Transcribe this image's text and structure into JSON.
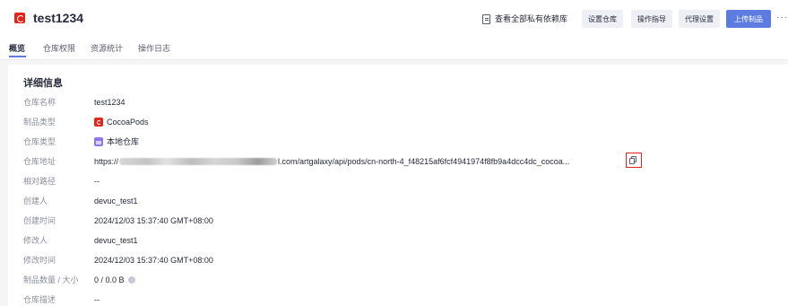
{
  "header": {
    "title": "test1234",
    "deps_link": "查看全部私有依赖库",
    "buttons": {
      "settings": "设置仓库",
      "guide": "操作指导",
      "proxy": "代理设置",
      "upload": "上传制品"
    },
    "more": "···"
  },
  "tabs": [
    {
      "label": "概览",
      "active": true
    },
    {
      "label": "仓库权限"
    },
    {
      "label": "资源统计"
    },
    {
      "label": "操作日志"
    }
  ],
  "detail": {
    "section_title": "详细信息",
    "rows": [
      {
        "label": "仓库名称",
        "value": "test1234"
      },
      {
        "label": "制品类型",
        "value": "CocoaPods",
        "icon": "cocoapods-icon"
      },
      {
        "label": "仓库类型",
        "value": "本地仓库",
        "icon": "local-repo-icon"
      },
      {
        "label": "仓库地址",
        "url_prefix": "https://",
        "url_suffix": "l.com/artgalaxy/api/pods/cn-north-4_f48215af6fcf4941974f8fb9a4dcc4dc_cocoa..."
      },
      {
        "label": "相对路径",
        "value": "--"
      },
      {
        "label": "创建人",
        "value": "devuc_test1"
      },
      {
        "label": "创建时间",
        "value": "2024/12/03 15:37:40 GMT+08:00"
      },
      {
        "label": "修改人",
        "value": "devuc_test1"
      },
      {
        "label": "修改时间",
        "value": "2024/12/03 15:37:40 GMT+08:00"
      },
      {
        "label": "制品数量 / 大小",
        "value": "0 / 0.0 B",
        "icon": "help-icon"
      },
      {
        "label": "仓库描述",
        "value": "--"
      }
    ]
  },
  "colors": {
    "accent": "#5e7ce0",
    "brand_red": "#e1251b",
    "highlight_border": "#e1251b"
  }
}
